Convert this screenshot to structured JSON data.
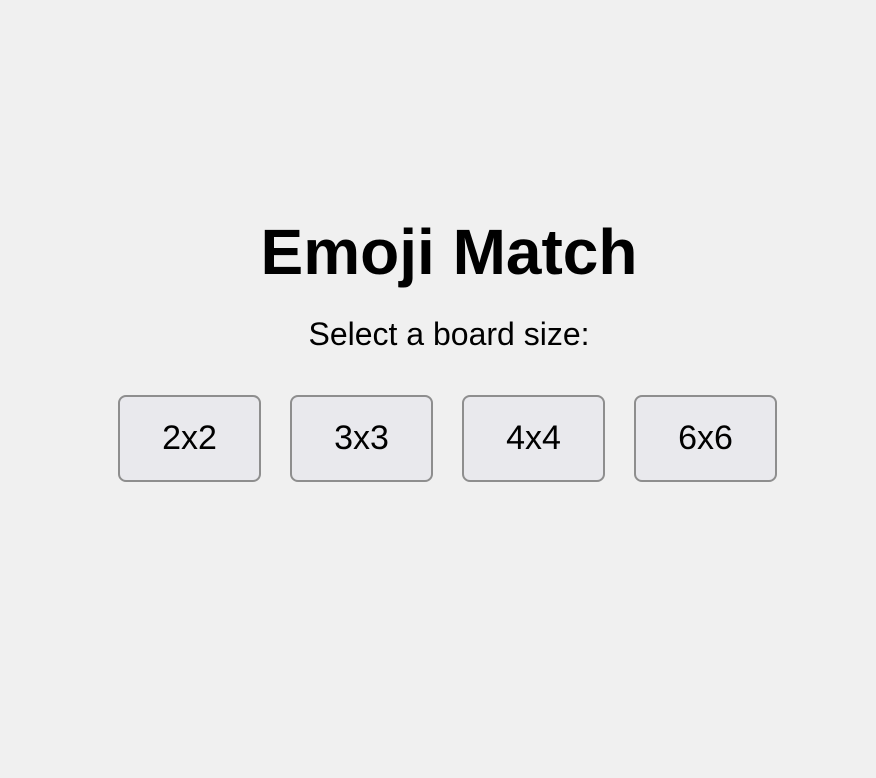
{
  "title": "Emoji Match",
  "prompt": "Select a board size:",
  "board_sizes": [
    {
      "label": "2x2"
    },
    {
      "label": "3x3"
    },
    {
      "label": "4x4"
    },
    {
      "label": "6x6"
    }
  ],
  "colors": {
    "background": "#f0f0f0",
    "button_background": "#e9e9ed",
    "button_border": "#8e8e8e",
    "text": "#000000"
  }
}
